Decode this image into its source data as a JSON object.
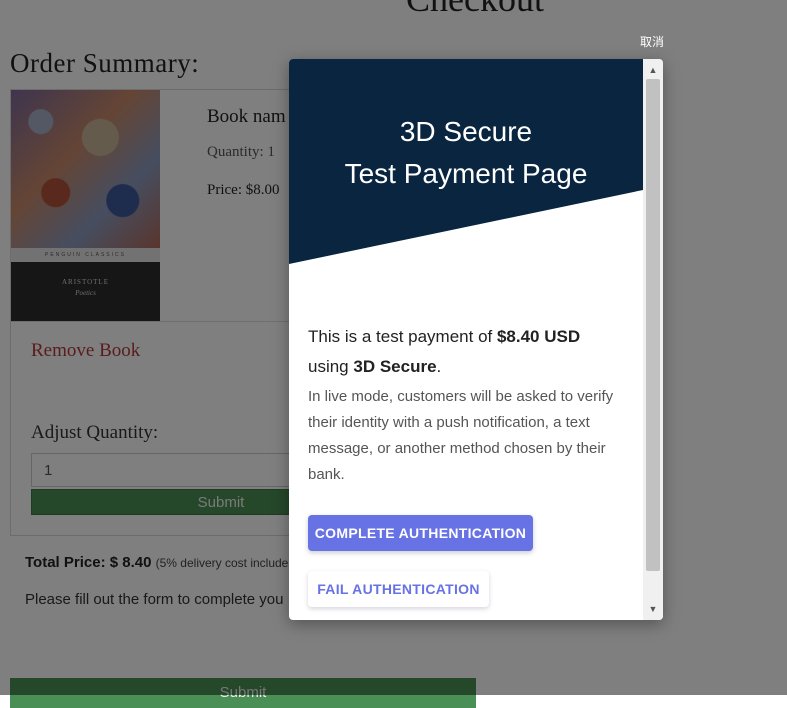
{
  "page": {
    "title": "Checkout",
    "summary_heading": "Order Summary:",
    "book": {
      "name": "Book nam",
      "quantity": "Quantity: 1",
      "price": "Price: $8.00",
      "cover": {
        "series": "PENGUIN CLASSICS",
        "author": "ARISTOTLE",
        "title": "Poetics"
      }
    },
    "remove_link": "Remove Book",
    "adjust_label": "Adjust Quantity:",
    "quantity_value": "1",
    "quantity_submit": "Submit",
    "total_label": "Total Price: $ 8.40",
    "total_note": "(5% delivery cost include",
    "fill_text": "Please fill out the form to complete you",
    "main_submit": "Submit"
  },
  "overlay": {
    "cancel_label": "取消"
  },
  "modal": {
    "hero_line1": "3D Secure",
    "hero_line2": "Test Payment Page",
    "lead_prefix": "This is a test payment of ",
    "lead_amount": "$8.40 USD",
    "lead_mid": "using ",
    "lead_method": "3D Secure",
    "lead_suffix": ".",
    "explanation": "In live mode, customers will be asked to verify their identity with a push notification, a text message, or another method chosen by their bank.",
    "complete_button": "COMPLETE AUTHENTICATION",
    "fail_button": "FAIL AUTHENTICATION"
  },
  "colors": {
    "hero_bg": "#0a2540",
    "accent": "#6772e5",
    "submit_green": "#4a8f55",
    "remove_red": "#b33a3a"
  },
  "icons": {
    "scroll_up": "triangle-up",
    "scroll_down": "triangle-down"
  }
}
